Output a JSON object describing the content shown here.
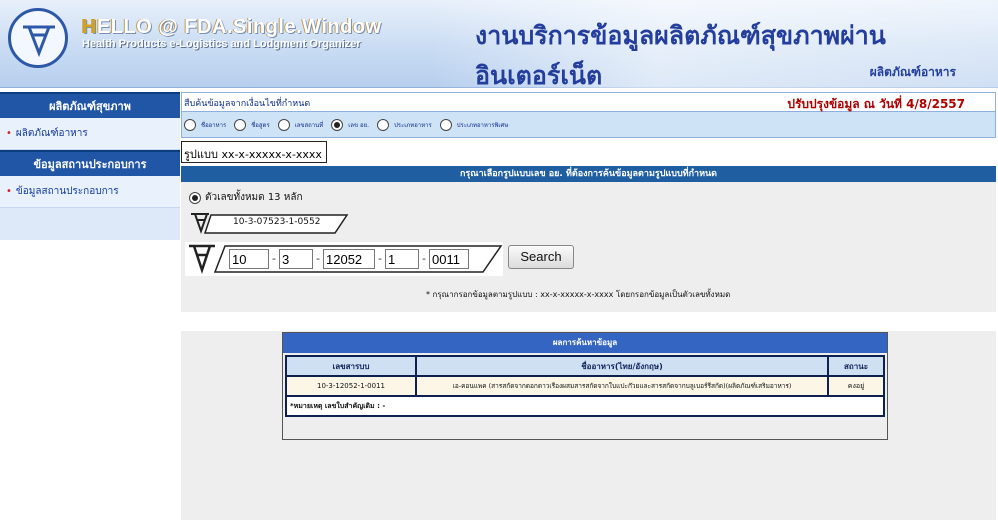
{
  "header": {
    "brand_prefix": "H",
    "brand_title": "ELLO @ FDA.Single.Window",
    "brand_subtitle": "Health Products e-Logistics and Lodgment Organizer",
    "thai_title": "งานบริการข้อมูลผลิตภัณฑ์สุขภาพผ่านอินเตอร์เน็ต",
    "section": "ผลิตภัณฑ์อาหาร"
  },
  "sidebar": {
    "head_products": "ผลิตภัณฑ์สุขภาพ",
    "item_food": "ผลิตภัณฑ์อาหาร",
    "head_premises": "ข้อมูลสถานประกอบการ",
    "item_premises": "ข้อมูลสถานประกอบการ"
  },
  "main": {
    "search_condition": "สืบค้นข้อมูลจากเงื่อนไขที่กำหนด",
    "update_text": "ปรับปรุงข้อมูล ณ วันที่ 4/8/2557",
    "radios": [
      {
        "label": "ชื่ออาหาร",
        "checked": false
      },
      {
        "label": "ชื่อสูตร",
        "checked": false
      },
      {
        "label": "เลขสถานที่",
        "checked": false
      },
      {
        "label": "เลข อย.",
        "checked": true
      },
      {
        "label": "ประเภทอาหาร",
        "checked": false
      },
      {
        "label": "ประเภทอาหารพิเศษ",
        "checked": false
      }
    ],
    "format_label": "รูปแบบ xx-x-xxxxx-x-xxxx",
    "instruction": "กรุณาเลือกรูปแบบเลข อย. ที่ต้องการค้นข้อมูลตามรูปแบบที่กำหนด",
    "option_13_digits": "ตัวเลขทั้งหมด 13 หลัก",
    "sample_number": "10-3-07523-1-0552",
    "segments": [
      "10",
      "3",
      "12052",
      "1",
      "0011"
    ],
    "search_button": "Search",
    "note": "* กรุณากรอกข้อมูลตามรูปแบบ : xx-x-xxxxx-x-xxxx โดยกรอกข้อมูลเป็นตัวเลขทั้งหมด"
  },
  "results": {
    "title": "ผลการค้นหาข้อมูล",
    "columns": [
      "เลขสารบบ",
      "ชื่ออาหาร(ไทย/อังกฤษ)",
      "สถานะ"
    ],
    "rows": [
      [
        "10-3-12052-1-0011",
        "เอ-คอนแพค (สารสกัดจากดอกดาวเรืองผสมสารสกัดจากใบแปะก๊วยและสารสกัดจากบลูเบอร์รีสกัด)(ผลิตภัณฑ์เสริมอาหาร)",
        "คงอยู่"
      ]
    ],
    "remark": "*หมายเหตุ เลขใบสำคัญเดิม : -"
  },
  "colors": {
    "sidebar_head": "#2156a6",
    "instruction_bar": "#1f5ea0",
    "result_head": "#3565c3",
    "update_text": "#b00000"
  }
}
